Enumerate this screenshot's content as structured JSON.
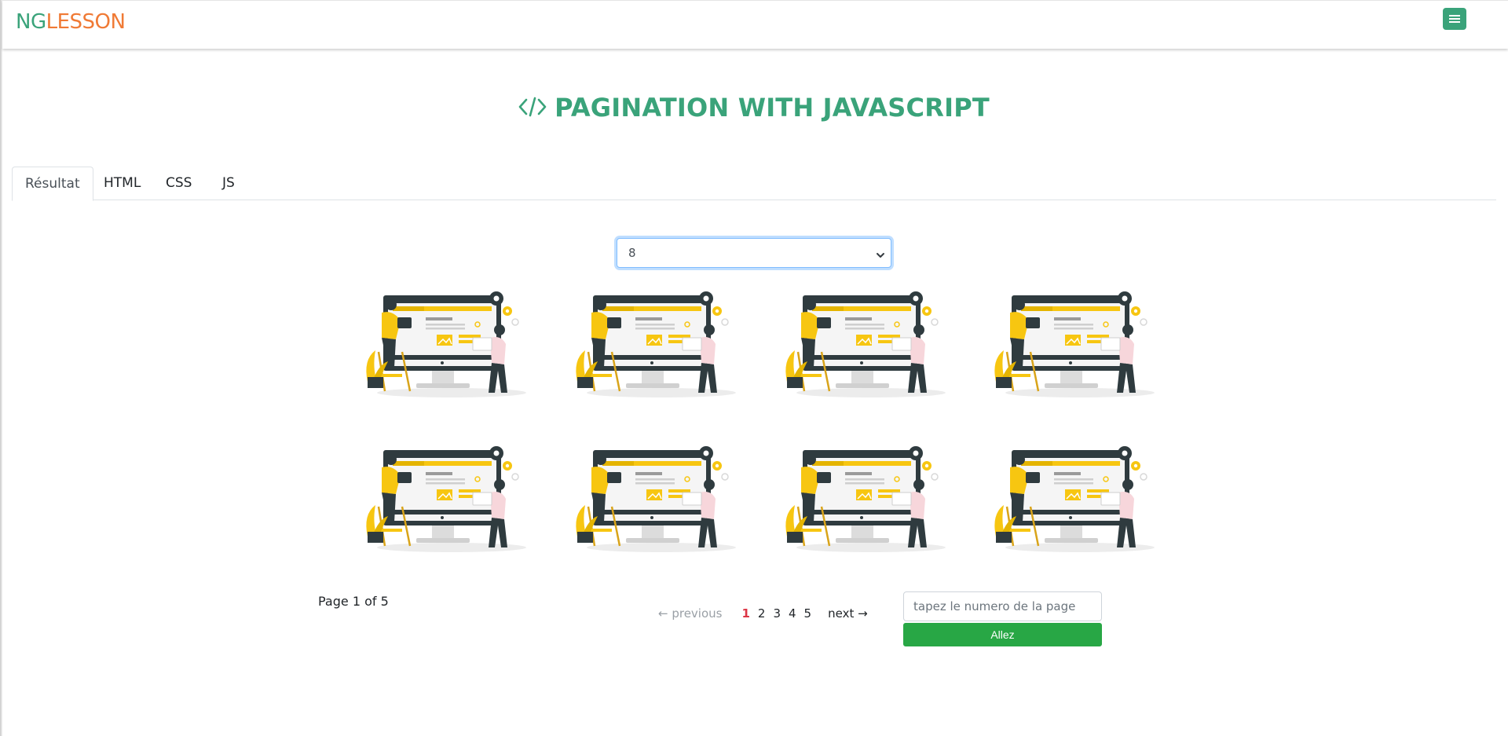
{
  "navbar": {
    "brand_ng": "NG",
    "brand_lesson": "LESSON",
    "brand_ng_color": "#3aa37a",
    "brand_lesson_color": "#f07a35",
    "menu_icon": "hamburger-menu-icon"
  },
  "page": {
    "title": "PAGINATION WITH JAVASCRIPT",
    "title_icon": "code-icon",
    "accent_color": "#3aa37a"
  },
  "tabs": [
    {
      "label": "Résultat",
      "active": true
    },
    {
      "label": "HTML",
      "active": false
    },
    {
      "label": "CSS",
      "active": false
    },
    {
      "label": "JS",
      "active": false
    }
  ],
  "per_page_select": {
    "selected": "8"
  },
  "gallery": {
    "image_subject": "web-development-illustration",
    "count": 8
  },
  "pagination": {
    "info": "Page 1 of 5",
    "previous_label": "← previous",
    "next_label": "next →",
    "pages": [
      "1",
      "2",
      "3",
      "4",
      "5"
    ],
    "current_page": "1",
    "current_color": "#dc3545"
  },
  "goto": {
    "placeholder": "tapez le numero de la page",
    "button_label": "Allez",
    "button_color": "#28a745"
  }
}
